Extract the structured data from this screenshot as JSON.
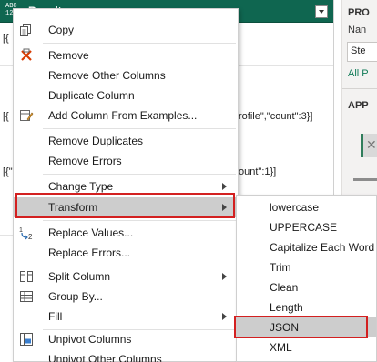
{
  "grid": {
    "column_type": "ABC\n123",
    "column_title": "Results",
    "row_fragments": [
      "[{",
      "[{",
      "[{",
      "[{\"",
      "rofile\",\"count\":3}]",
      "ount\":1}]"
    ]
  },
  "right_panel": {
    "properties_heading": "PRO",
    "name_label": "Nan",
    "name_value": "Ste",
    "all_properties_link": "All P",
    "applied_steps_heading": "APP",
    "step_icon": "close-icon"
  },
  "context_menu": {
    "items": [
      {
        "label": "Copy",
        "icon": "copy-icon"
      },
      {
        "label": "Remove",
        "icon": "remove-x-icon"
      },
      {
        "label": "Remove Other Columns",
        "icon": ""
      },
      {
        "label": "Duplicate Column",
        "icon": ""
      },
      {
        "label": "Add Column From Examples...",
        "icon": "add-column-examples-icon"
      },
      {
        "label": "Remove Duplicates",
        "icon": ""
      },
      {
        "label": "Remove Errors",
        "icon": ""
      },
      {
        "label": "Change Type",
        "icon": "",
        "submenu": true
      },
      {
        "label": "Transform",
        "icon": "",
        "submenu": true
      },
      {
        "label": "Replace Values...",
        "icon": "replace-values-icon"
      },
      {
        "label": "Replace Errors...",
        "icon": ""
      },
      {
        "label": "Split Column",
        "icon": "split-column-icon",
        "submenu": true
      },
      {
        "label": "Group By...",
        "icon": "group-by-icon"
      },
      {
        "label": "Fill",
        "icon": "",
        "submenu": true
      },
      {
        "label": "Unpivot Columns",
        "icon": "unpivot-icon"
      },
      {
        "label": "Unpivot Other Columns",
        "icon": ""
      }
    ]
  },
  "transform_submenu": {
    "items": [
      "lowercase",
      "UPPERCASE",
      "Capitalize Each Word",
      "Trim",
      "Clean",
      "Length",
      "JSON",
      "XML"
    ]
  },
  "colors": {
    "header_green": "#0f6650",
    "highlight_gray": "#cdcdcd",
    "annotation_red": "#d32020",
    "link_green": "#0f7b57"
  }
}
